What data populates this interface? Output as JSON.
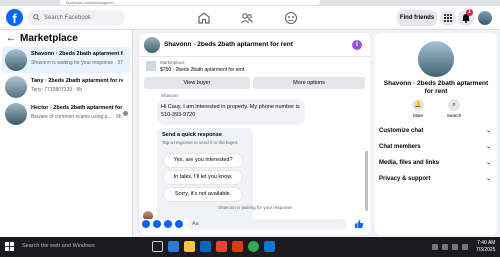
{
  "browser": {
    "url": "facebook.com/messages/t/..."
  },
  "topnav": {
    "search_placeholder": "Search Facebook",
    "find_friends": "Find friends",
    "notif_count": "1"
  },
  "sidebar": {
    "title": "Marketplace",
    "items": [
      {
        "title": "Shavonn · 2beds 2bath aptarment for rent",
        "sub": "Shavonn is waiting for your response · 37m"
      },
      {
        "title": "Tany · 2beds 2bath aptarment for rent",
        "sub": "Tany: 7713807339 · 8h"
      },
      {
        "title": "Hector · 2beds 2bath aptarment for ...",
        "sub": "Beware of common scams using p... · 9h"
      }
    ]
  },
  "chat": {
    "title": "Shavonn · 2beds 2bath aptarment for rent",
    "listing_label": "Marketplace",
    "listing_detail": "$750 · 2beds 2bath aptarment for rent",
    "view_buyer": "View buyer",
    "more_options": "More options",
    "sender": "Shavonn",
    "message": "Hi Cauy, I am interested in property. My phone number is 510-393-9720",
    "quick_title": "Send a quick response",
    "quick_sub": "Tap a response to send it to the buyer.",
    "quick_options": [
      "Yes, are you interested?",
      "In talks. I'll let you know.",
      "Sorry, it's not available."
    ],
    "waiting": "Shavonn is waiting for your response",
    "compose_placeholder": "Aa"
  },
  "details": {
    "name": "Shavonn · 2beds 2bath aptarment for rent",
    "mute": "Mute",
    "search": "Search",
    "sections": [
      "Customize chat",
      "Chat members",
      "Media, files and links",
      "Privacy & support"
    ]
  },
  "taskbar": {
    "search": "Search the web and Windows",
    "time": "7:40 AM",
    "date": "7/3/2025"
  }
}
